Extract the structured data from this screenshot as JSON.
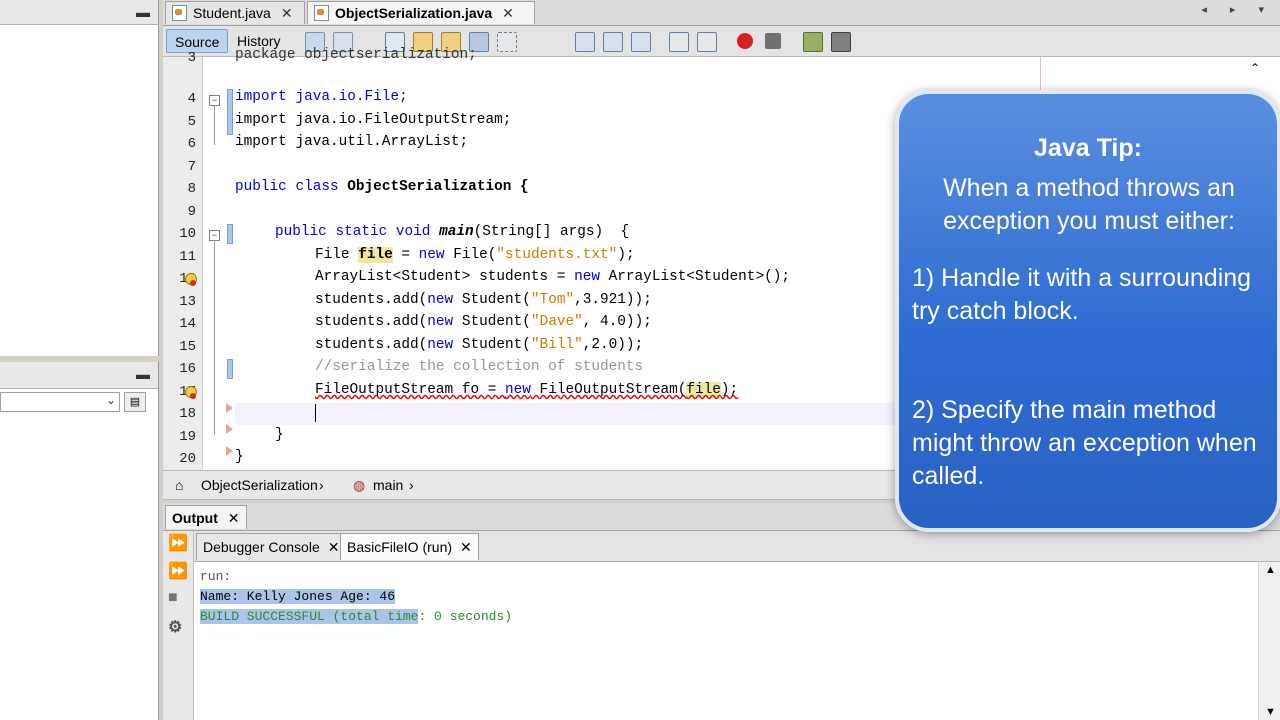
{
  "editor_tabs": [
    {
      "label": "Student.java",
      "close": "✕"
    },
    {
      "label": "ObjectSerialization.java",
      "close": "✕"
    }
  ],
  "nav_arrows": "◂ ▸ ▾",
  "toolbar": {
    "source": "Source",
    "history": "History"
  },
  "code": {
    "line_numbers": [
      "3",
      "4",
      "5",
      "6",
      "7",
      "8",
      "9",
      "10",
      "11",
      "12",
      "13",
      "14",
      "15",
      "16",
      "17",
      "18",
      "19",
      "20"
    ],
    "line0": "package objectserialization;",
    "line_import1": "import java.io.File;",
    "line_import2": "import java.io.FileOutputStream;",
    "line_import3": "import java.util.ArrayList;",
    "class_kw": "public class",
    "class_name": " ObjectSerialization {",
    "main_kw": "public static void",
    "main_name": "main",
    "main_sig": "(String[] args)  {",
    "l11_a": "File ",
    "l11_var": "file",
    "l11_b": " = ",
    "l11_new": "new",
    "l11_c": " File(",
    "l11_str": "\"students.txt\"",
    "l11_d": ");",
    "l12_a": "ArrayList<Student> students = ",
    "l12_new": "new",
    "l12_b": " ArrayList<Student>();",
    "l13_a": "students.add(",
    "l13_new": "new",
    "l13_b": " Student(",
    "l13_str": "\"Tom\"",
    "l13_c": ",3.921));",
    "l14_str": "\"Dave\"",
    "l14_c": ", 4.0));",
    "l15_str": "\"Bill\"",
    "l15_c": ",2.0));",
    "l16_comment": "//serialize the collection of students",
    "l17_a": "FileOutputStream fo = ",
    "l17_new": "new",
    "l17_b": " FileOutputStream(",
    "l17_var": "file",
    "l17_c": ");",
    "l19": "}",
    "l20": "}"
  },
  "breadcrumb": {
    "class": "ObjectSerialization",
    "method": "main"
  },
  "output": {
    "title": "Output",
    "tabs": [
      {
        "label": "Debugger Console",
        "close": "✕"
      },
      {
        "label": "BasicFileIO (run)",
        "close": "✕"
      }
    ],
    "lines": [
      "run:",
      "Name: Kelly Jones Age: 46",
      "BUILD SUCCESSFUL (total time",
      ": 0 seconds)"
    ]
  },
  "tip": {
    "title": "Java Tip:",
    "intro": "When a method throws an exception you must either:",
    "point1": "1) Handle it with a surrounding try catch block.",
    "point2": "2) Specify the main method might throw an exception when called."
  },
  "colors": {
    "keyword": "#0000e6",
    "string": "#ce7b00",
    "comment": "#969696",
    "tip_bg": "#2f6cd2"
  }
}
